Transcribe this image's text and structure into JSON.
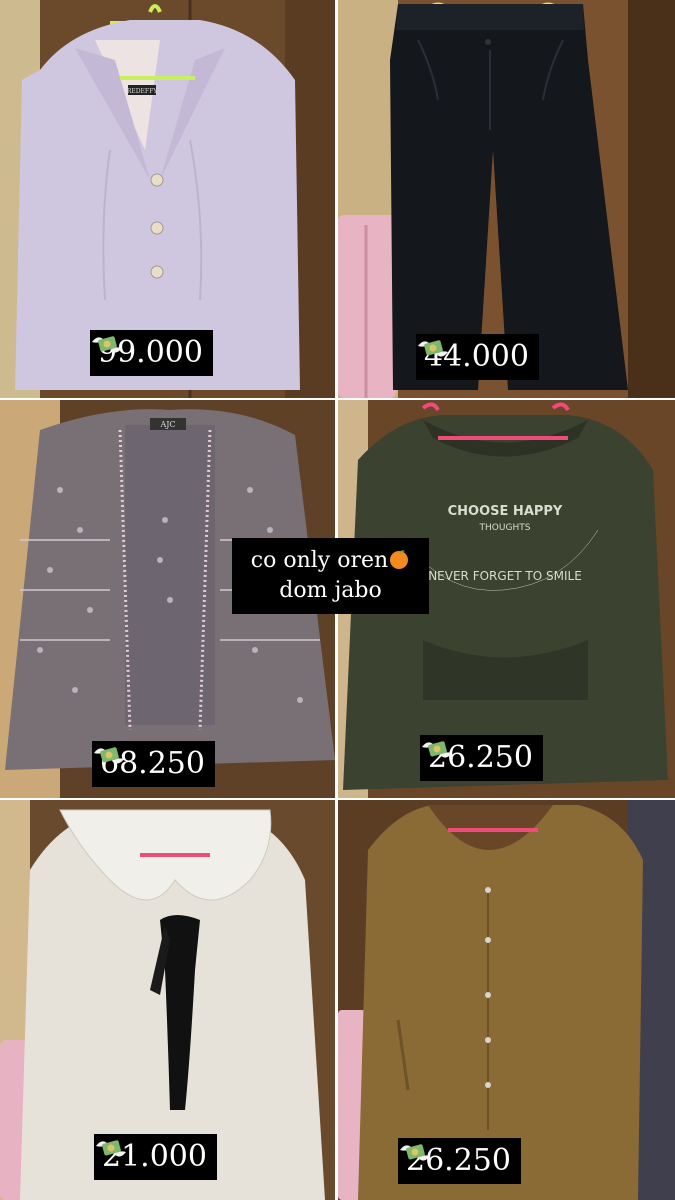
{
  "items": [
    {
      "id": "lilac-blazer",
      "price": "99.000"
    },
    {
      "id": "black-trousers",
      "price": "44.000"
    },
    {
      "id": "grey-embroidered-set",
      "price": "68.250"
    },
    {
      "id": "green-sweatshirt",
      "price": "26.250"
    },
    {
      "id": "white-collar-blouse",
      "price": "21.000"
    },
    {
      "id": "brown-button-blouse",
      "price": "26.250"
    }
  ],
  "sweatshirt_print": {
    "line1": "CHOOSE HAPPY",
    "line2": "THOUGHTS",
    "line3": "NEVER FORGET TO SMILE"
  },
  "label_blazer": "REDEFFY",
  "label_set": "AJC",
  "note": {
    "line1": "co only oren",
    "line2": "dom jabo"
  },
  "icons": {
    "price": "money-with-wings-icon",
    "note": "orange-fruit-icon"
  },
  "colors": {
    "price_bg": "#000000",
    "price_text": "#ffffff"
  }
}
